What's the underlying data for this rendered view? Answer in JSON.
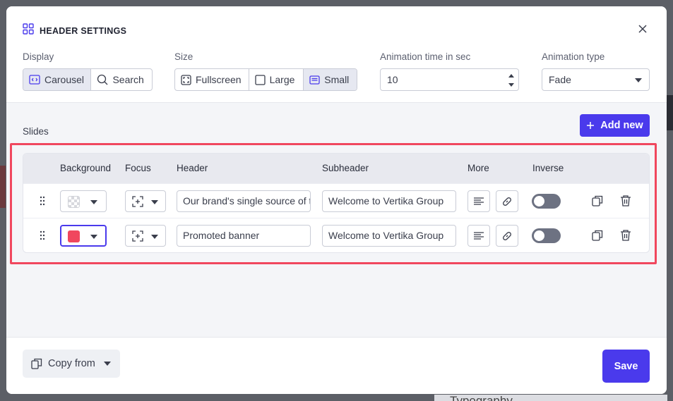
{
  "modal": {
    "title": "HEADER SETTINGS"
  },
  "display": {
    "label": "Display",
    "options": [
      "Carousel",
      "Search"
    ],
    "selected": "Carousel"
  },
  "size": {
    "label": "Size",
    "options": [
      "Fullscreen",
      "Large",
      "Small"
    ],
    "selected": "Small"
  },
  "animation_time": {
    "label": "Animation time in sec",
    "value": "10"
  },
  "animation_type": {
    "label": "Animation type",
    "value": "Fade"
  },
  "slides": {
    "label": "Slides",
    "add_label": "Add new",
    "columns": [
      "Background",
      "Focus",
      "Header",
      "Subheader",
      "More",
      "Inverse"
    ],
    "rows": [
      {
        "background": "transparent",
        "header": "Our brand's single source of truth",
        "subheader": "Welcome to Vertika Group",
        "inverse": false
      },
      {
        "background": "#f0475e",
        "header": "Promoted banner",
        "subheader": "Welcome to Vertika Group",
        "inverse": false
      }
    ]
  },
  "footer": {
    "copy_label": "Copy from",
    "save_label": "Save"
  },
  "background_page": {
    "text": "Typography"
  },
  "colors": {
    "accent": "#4a3aec",
    "highlight": "#f0475e"
  }
}
